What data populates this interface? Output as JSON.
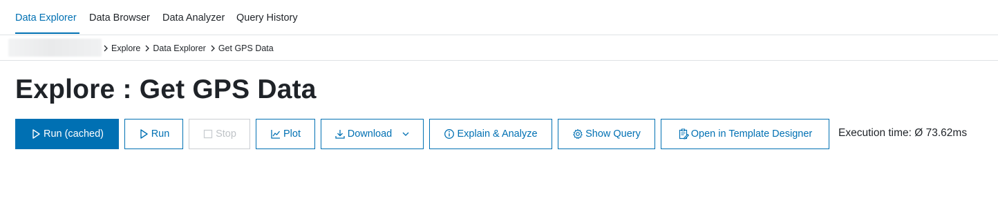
{
  "tabs": [
    {
      "label": "Data Explorer",
      "active": true
    },
    {
      "label": "Data Browser",
      "active": false
    },
    {
      "label": "Data Analyzer",
      "active": false
    },
    {
      "label": "Query History",
      "active": false
    }
  ],
  "breadcrumb": {
    "items": [
      "Explore",
      "Data Explorer",
      "Get GPS Data"
    ]
  },
  "page_title": "Explore : Get GPS Data",
  "toolbar": {
    "run_cached": {
      "label": "Run (cached)",
      "icon": "play-icon"
    },
    "run": {
      "label": "Run",
      "icon": "play-icon"
    },
    "stop": {
      "label": "Stop",
      "icon": "stop-icon",
      "disabled": true
    },
    "plot": {
      "label": "Plot",
      "icon": "chart-line-icon"
    },
    "download": {
      "label": "Download",
      "icon": "download-icon"
    },
    "explain": {
      "label": "Explain & Analyze",
      "icon": "info-icon"
    },
    "show_query": {
      "label": "Show Query",
      "icon": "gear-icon"
    },
    "template": {
      "label": "Open in Template Designer",
      "icon": "clipboard-edit-icon"
    }
  },
  "execution_time": "Execution time: Ø 73.62ms",
  "colors": {
    "accent": "#0070b3",
    "text": "#1f2328",
    "border": "#dfe2e5",
    "disabled": "#bfc3c7"
  }
}
